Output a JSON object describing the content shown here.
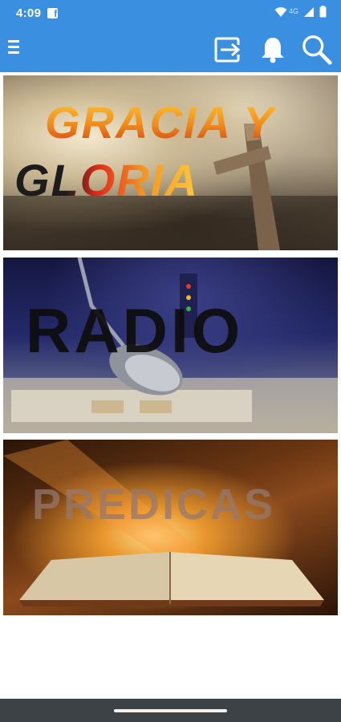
{
  "status_bar": {
    "time": "4:09",
    "notification_icon": "facebook-icon",
    "network_label": "4G",
    "icons": [
      "wifi-icon",
      "signal-icon",
      "battery-icon"
    ]
  },
  "app_bar": {
    "menu_icon": "hamburger-menu-icon",
    "actions": [
      "exit-icon",
      "bell-icon",
      "search-icon"
    ],
    "color": "#3b8fe0"
  },
  "cards": [
    {
      "id": "gracia-y-gloria",
      "line1": "GRACIA Y",
      "line2": "GLORIA"
    },
    {
      "id": "radio",
      "title": "RADIO"
    },
    {
      "id": "predicas",
      "title": "PREDICAS"
    }
  ],
  "nav_bar": {
    "color": "#3d4246"
  }
}
